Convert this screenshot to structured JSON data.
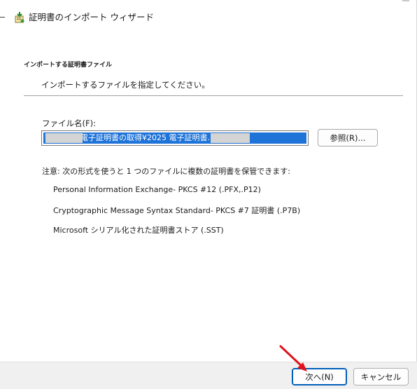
{
  "window": {
    "title": "証明書のインポート ウィザード"
  },
  "header": {
    "title": "インポートする証明書ファイル",
    "description": "インポートするファイルを指定してください。"
  },
  "file": {
    "label": "ファイル名(F):",
    "value": "           ¥商業登記電子証明書の取得¥2025              電子証明書.p12"
  },
  "browse_button": "参照(R)...",
  "note": "注意: 次の形式を使うと 1 つのファイルに複数の証明書を保管できます:",
  "formats": [
    "Personal Information Exchange- PKCS #12 (.PFX,.P12)",
    "Cryptographic Message Syntax Standard- PKCS #7 証明書 (.P7B)",
    "Microsoft シリアル化された証明書ストア (.SST)"
  ],
  "footer": {
    "next_label": "次へ(N)",
    "cancel_label": "キャンセル"
  },
  "annotation": {
    "arrow_color": "#e0121b"
  },
  "icons": {
    "title_icon": "certificate-import-icon"
  }
}
